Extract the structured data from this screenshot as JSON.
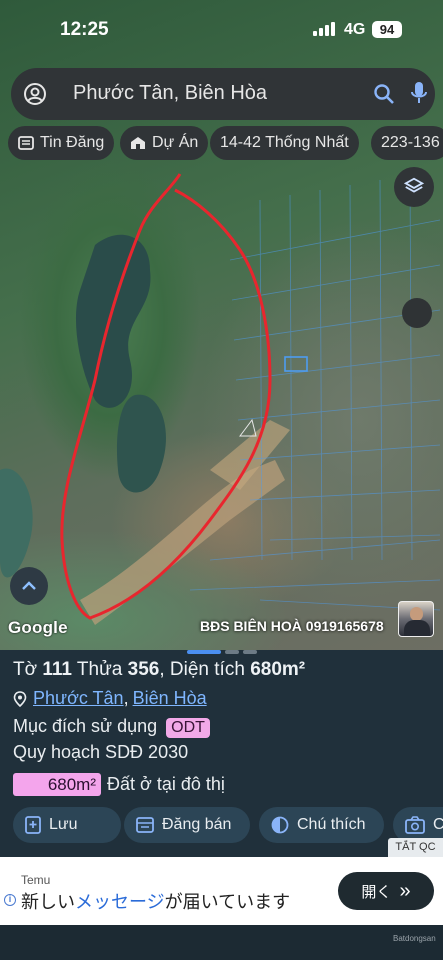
{
  "status_bar": {
    "time": "12:25",
    "network": "4G",
    "battery": "94"
  },
  "search": {
    "text": "Phước Tân, Biên Hòa"
  },
  "chips": [
    {
      "label": "Tin Đăng",
      "icon": "news-icon"
    },
    {
      "label": "Dự Án",
      "icon": "building-icon"
    },
    {
      "label": "14-42 Thống Nhất",
      "icon": ""
    },
    {
      "label": "223-136",
      "icon": ""
    }
  ],
  "map": {
    "attribution": "Google",
    "watermark": "BĐS BIÊN HOÀ 0919165678",
    "boundary_color": "#e8262e",
    "parcel_color": "#4d9cf0"
  },
  "info": {
    "title_prefix": "Tờ",
    "sheet_no": "111",
    "parcel_prefix": "Thửa",
    "parcel_no": "356",
    "area_prefix": ", Diện tích",
    "area": "680m²",
    "location_ward": "Phước Tân",
    "location_sep": ",",
    "location_city": "Biên Hòa",
    "purpose_label": "Mục đích sử dụng",
    "purpose_code": "ODT",
    "plan_label": "Quy hoạch SDĐ 2030",
    "area_badge": "680m²",
    "area_type": "Đất ở tại đô thị"
  },
  "actions": [
    {
      "label": "Lưu",
      "icon": "bookmark-plus-icon"
    },
    {
      "label": "Đăng bán",
      "icon": "listing-icon"
    },
    {
      "label": "Chú thích",
      "icon": "half-circle-icon"
    },
    {
      "label": "C",
      "icon": "camera-icon"
    }
  ],
  "ad": {
    "close_label": "TẮT QC",
    "brand": "Temu",
    "text_before": "新しい",
    "text_highlight": "メッセージ",
    "text_after": "が届いています",
    "button_label": "開く",
    "button_arrow": "»",
    "info_icon": "i",
    "footer_logo": "Batdongsan"
  }
}
